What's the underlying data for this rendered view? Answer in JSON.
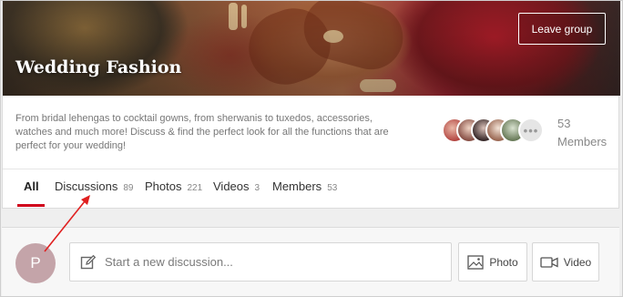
{
  "group": {
    "title": "Wedding Fashion",
    "leave_label": "Leave group",
    "description": "From bridal lehengas to cocktail gowns, from sherwanis to tuxedos, accessories, watches and much more! Discuss & find the perfect look for all the functions that are perfect for your wedding!",
    "members": {
      "count": "53",
      "label": "Members",
      "more_glyph": "•••"
    }
  },
  "tabs": [
    {
      "label": "All",
      "count": "",
      "active": true
    },
    {
      "label": "Discussions",
      "count": "89"
    },
    {
      "label": "Photos",
      "count": "221"
    },
    {
      "label": "Videos",
      "count": "3"
    },
    {
      "label": "Members",
      "count": "53"
    }
  ],
  "composer": {
    "avatar_initial": "P",
    "placeholder": "Start a new discussion...",
    "photo_label": "Photo",
    "video_label": "Video"
  },
  "colors": {
    "accent": "#d0021b",
    "avatar_bg": "#c4a4a9",
    "annotation": "#e02020"
  },
  "icons": [
    "pencil-icon",
    "photo-icon",
    "video-camera-icon"
  ]
}
